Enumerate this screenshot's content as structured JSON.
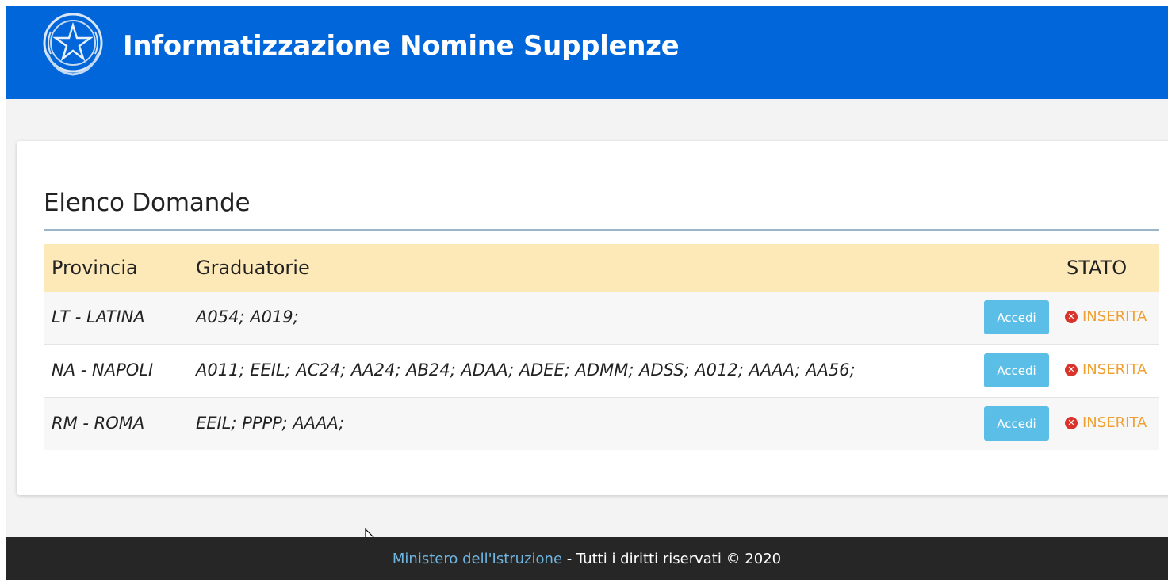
{
  "header": {
    "title": "Informatizzazione Nomine Supplenze",
    "emblem_icon": "italian-republic-emblem-icon"
  },
  "section": {
    "title": "Elenco Domande"
  },
  "table": {
    "columns": {
      "provincia": "Provincia",
      "graduatorie": "Graduatorie",
      "stato": "STATO"
    },
    "rows": [
      {
        "provincia": "LT - LATINA",
        "graduatorie": "A054; A019;",
        "button": "Accedi",
        "stato": "INSERITA"
      },
      {
        "provincia": "NA - NAPOLI",
        "graduatorie": "A011; EEIL; AC24; AA24; AB24; ADAA; ADEE; ADMM; ADSS; A012; AAAA; AA56;",
        "button": "Accedi",
        "stato": "INSERITA"
      },
      {
        "provincia": "RM - ROMA",
        "graduatorie": "EEIL; PPPP; AAAA;",
        "button": "Accedi",
        "stato": "INSERITA"
      }
    ]
  },
  "footer": {
    "link": "Ministero dell'Istruzione",
    "text": " - Tutti i diritti riservati © 2020"
  },
  "colors": {
    "header_bg": "#0066d9",
    "table_header_bg": "#fde9b8",
    "button_bg": "#5bbee6",
    "status_text": "#f0a030",
    "status_icon": "#d9342b",
    "footer_bg": "#262626",
    "footer_link": "#6fb6e3"
  }
}
